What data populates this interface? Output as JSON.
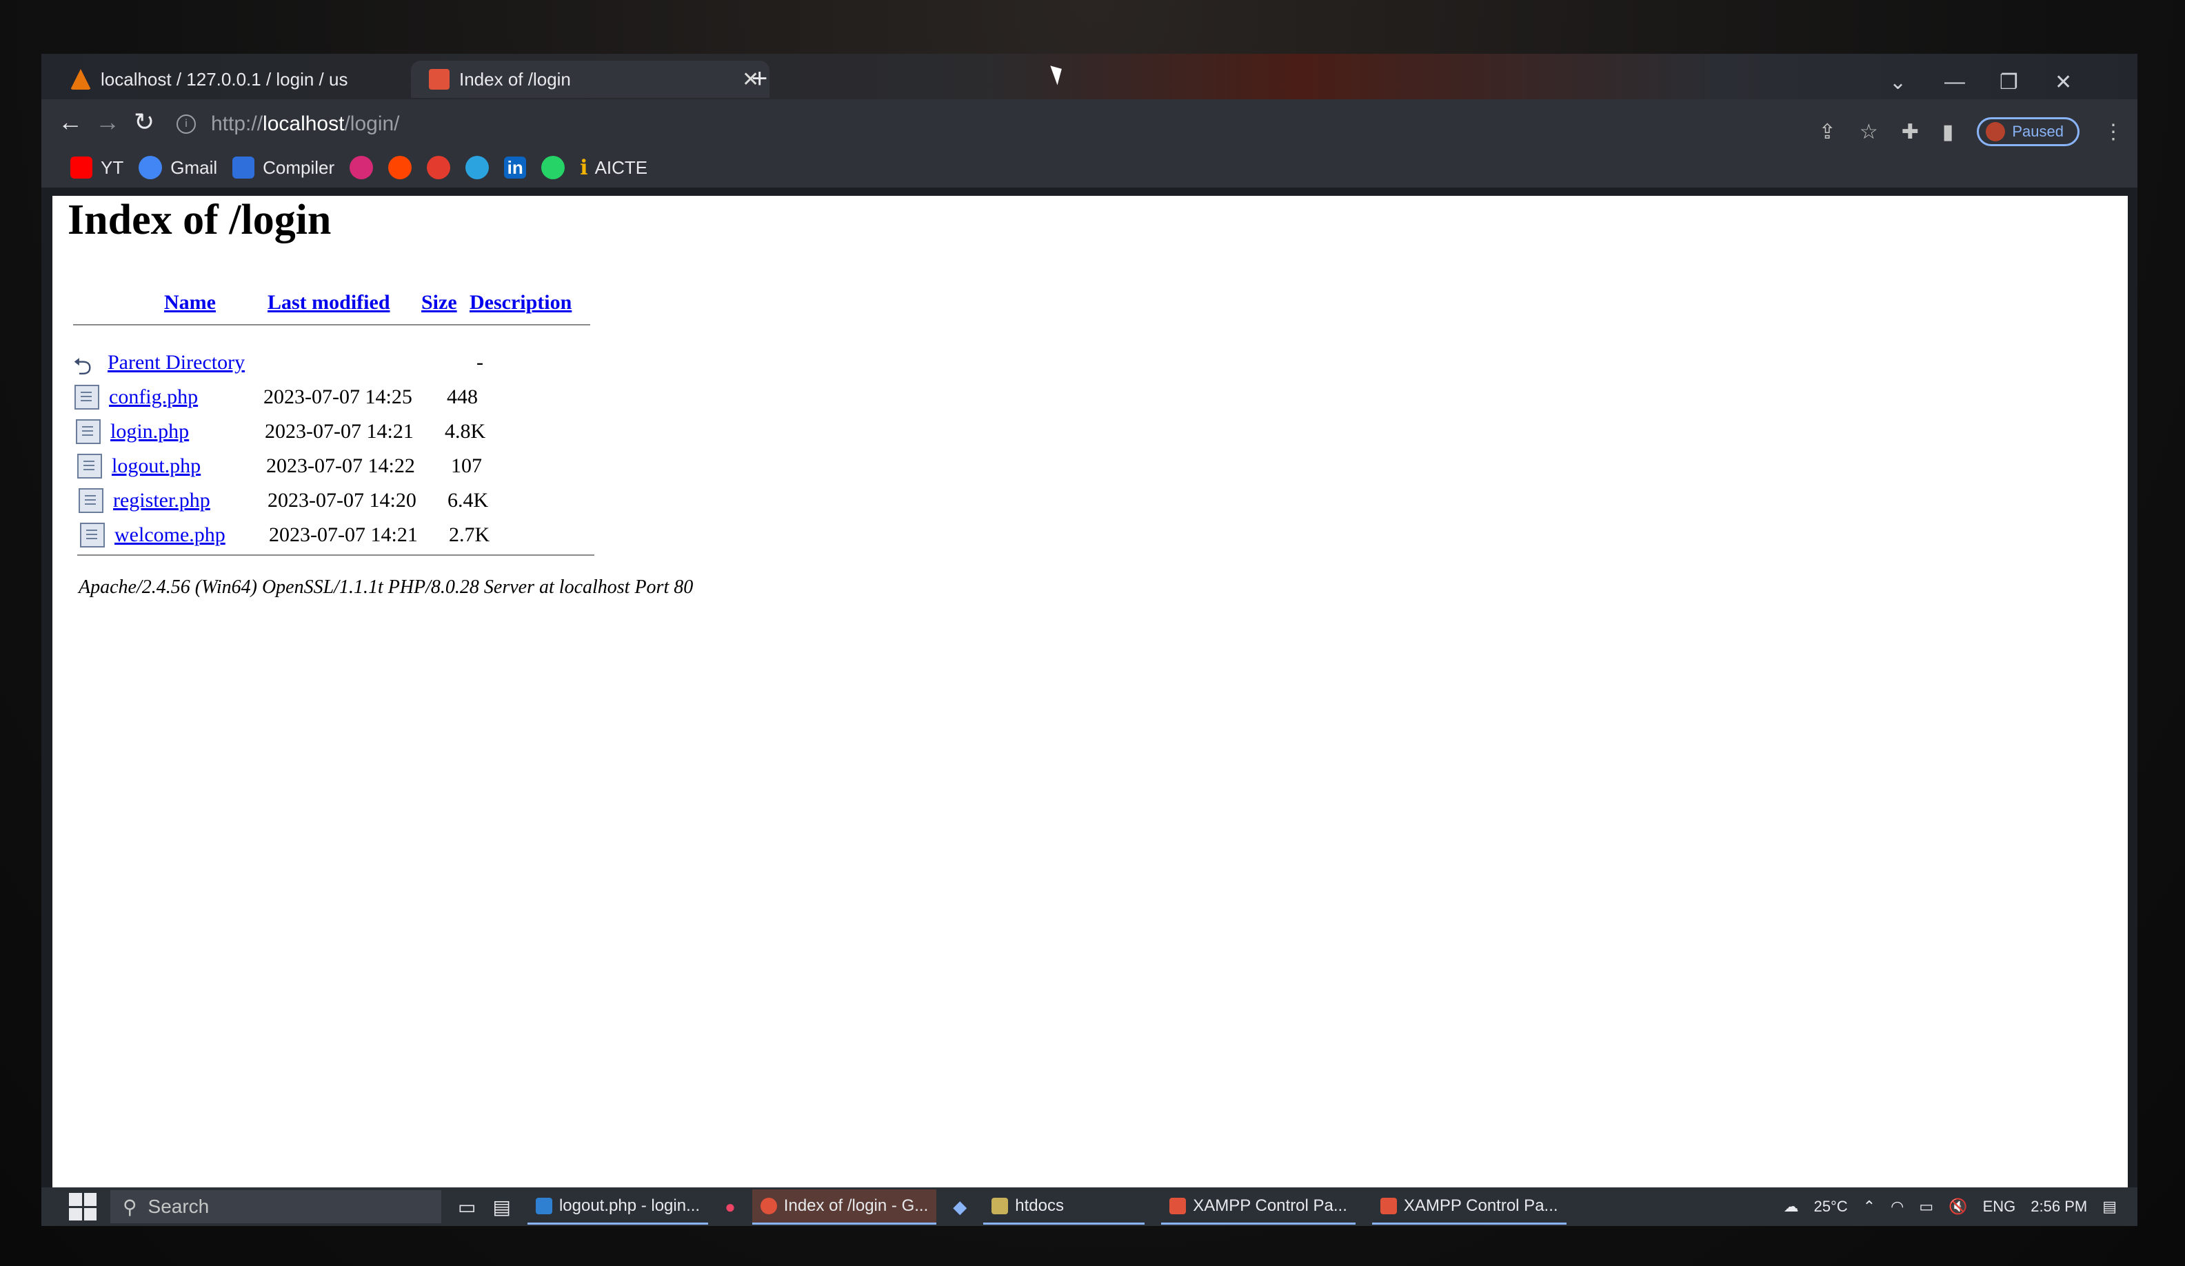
{
  "browser": {
    "tabs": [
      {
        "title": "localhost / 127.0.0.1 / login / us"
      },
      {
        "title": "Index of /login"
      }
    ],
    "new_tab": "+",
    "url": {
      "scheme": "http://",
      "host": "localhost",
      "path": "/login/"
    },
    "profile_status": "Paused",
    "bookmarks": [
      {
        "label": "YT",
        "icon": "youtube-icon",
        "color": "#ff0000"
      },
      {
        "label": "Gmail",
        "icon": "google-icon",
        "color": "#4285f4"
      },
      {
        "label": "Compiler",
        "icon": "compiler-icon",
        "color": "#2f6fdb"
      },
      {
        "label": "",
        "icon": "instagram-icon",
        "color": "#d62976"
      },
      {
        "label": "",
        "icon": "reddit-icon",
        "color": "#ff4500"
      },
      {
        "label": "",
        "icon": "c-icon",
        "color": "#e33b2e"
      },
      {
        "label": "",
        "icon": "telegram-icon",
        "color": "#2aa3df"
      },
      {
        "label": "in",
        "icon": "linkedin-icon",
        "color": "#0a66c2"
      },
      {
        "label": "",
        "icon": "whatsapp-icon",
        "color": "#25d366"
      },
      {
        "label": "AICTE",
        "icon": "aicte-icon",
        "color": "#f2b400"
      }
    ]
  },
  "page": {
    "title": "Index of /login",
    "headers": {
      "name": "Name",
      "last_modified": "Last modified",
      "size": "Size",
      "description": "Description"
    },
    "parent": {
      "label": "Parent Directory",
      "size": "-"
    },
    "files": [
      {
        "name": "config.php",
        "modified": "2023-07-07 14:25",
        "size": "448"
      },
      {
        "name": "login.php",
        "modified": "2023-07-07 14:21",
        "size": "4.8K"
      },
      {
        "name": "logout.php",
        "modified": "2023-07-07 14:22",
        "size": "107"
      },
      {
        "name": "register.php",
        "modified": "2023-07-07 14:20",
        "size": "6.4K"
      },
      {
        "name": "welcome.php",
        "modified": "2023-07-07 14:21",
        "size": "2.7K"
      }
    ],
    "footer": "Apache/2.4.56 (Win64) OpenSSL/1.1.1t PHP/8.0.28 Server at localhost Port 80"
  },
  "taskbar": {
    "search_placeholder": "Search",
    "items": [
      {
        "label": "logout.php - login..."
      },
      {
        "label": "Index of /login - G..."
      },
      {
        "label": "htdocs"
      },
      {
        "label": "XAMPP Control Pa..."
      },
      {
        "label": "XAMPP Control Pa..."
      }
    ],
    "temperature": "25°C",
    "language": "ENG",
    "time": "2:56 PM"
  }
}
